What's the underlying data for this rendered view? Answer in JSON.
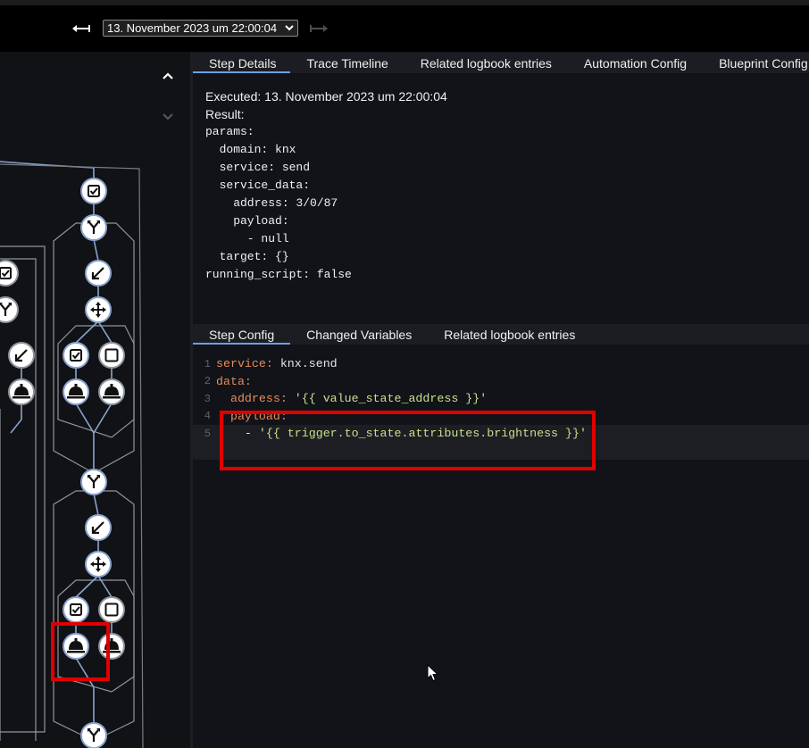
{
  "toolbar": {
    "trace_selected": "13. November 2023 um 22:00:04",
    "prev_icon": "arrow-left-right-icon",
    "next_icon": "arrow-left-right-icon"
  },
  "graph": {
    "collapse_up_icon": "chevron-up-icon",
    "expand_down_icon": "chevron-down-icon"
  },
  "tabs_top": [
    "Step Details",
    "Trace Timeline",
    "Related logbook entries",
    "Automation Config",
    "Blueprint Config"
  ],
  "details": {
    "executed": "Executed: 13. November 2023 um 22:00:04",
    "result": "Result:",
    "yaml": "params:\n  domain: knx\n  service: send\n  service_data:\n    address: 3/0/87\n    payload:\n      - null\n  target: {}\nrunning_script: false"
  },
  "tabs_bottom": [
    "Step Config",
    "Changed Variables",
    "Related logbook entries"
  ],
  "code": {
    "line_numbers": [
      "1",
      "2",
      "3",
      "4",
      "5"
    ],
    "l1_key": "service:",
    "l1_val": " knx.send",
    "l2_key": "data:",
    "l3_key": "  address:",
    "l3_val": " '{{ value_state_address }}'",
    "l4_key": "  payload:",
    "l5_dash": "    - ",
    "l5_val": "'{{ trigger.to_state.attributes.brightness }}'"
  },
  "colors": {
    "accent": "#6aa0e8",
    "highlight": "#e00000",
    "yaml_key": "#e88b5a",
    "yaml_string": "#c6e08a"
  }
}
